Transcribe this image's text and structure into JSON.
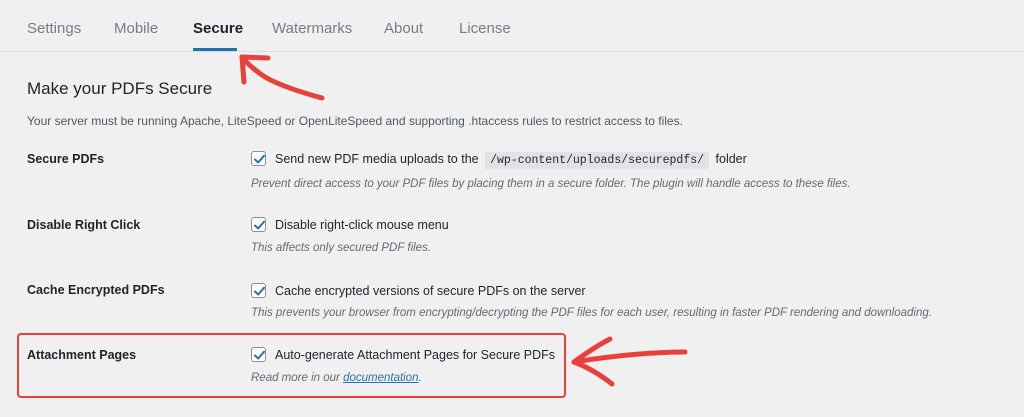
{
  "tabs": [
    {
      "label": "Settings"
    },
    {
      "label": "Mobile"
    },
    {
      "label": "Secure"
    },
    {
      "label": "Watermarks"
    },
    {
      "label": "About"
    },
    {
      "label": "License"
    }
  ],
  "active_tab": "Secure",
  "section": {
    "heading": "Make your PDFs Secure",
    "intro": "Your server must be running Apache, LiteSpeed or OpenLiteSpeed and supporting .htaccess rules to restrict access to files."
  },
  "settings": [
    {
      "label": "Secure PDFs",
      "checked": true,
      "text_before": "Send new PDF media uploads to the",
      "code": "/wp-content/uploads/securepdfs/",
      "text_after": "folder",
      "description": "Prevent direct access to your PDF files by placing them in a secure folder. The plugin will handle access to these files."
    },
    {
      "label": "Disable Right Click",
      "checked": true,
      "text": "Disable right-click mouse menu",
      "description": "This affects only secured PDF files."
    },
    {
      "label": "Cache Encrypted PDFs",
      "checked": true,
      "text": "Cache encrypted versions of secure PDFs on the server",
      "description": "This prevents your browser from encrypting/decrypting the PDF files for each user, resulting in faster PDF rendering and downloading."
    },
    {
      "label": "Attachment Pages",
      "checked": true,
      "text": "Auto-generate Attachment Pages for Secure PDFs",
      "description_prefix": "Read more in our",
      "link": "documentation",
      "description_suffix": "."
    }
  ],
  "colors": {
    "accent": "#2271b1",
    "annotation": "#e8403a"
  },
  "icons": [
    "checkmark-icon",
    "annotation-arrow-icon"
  ]
}
